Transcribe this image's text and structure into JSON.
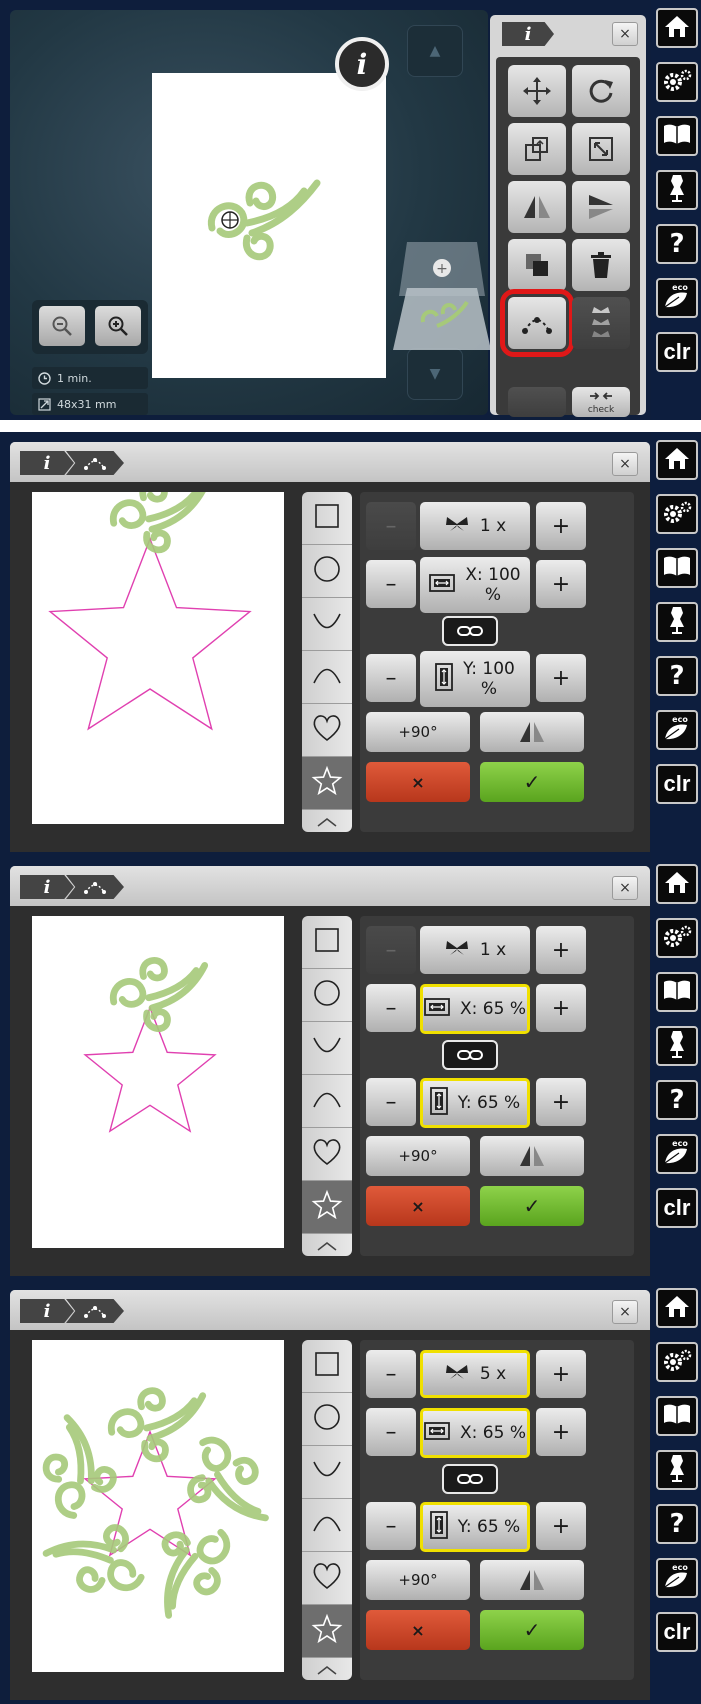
{
  "sidebar": {
    "buttons": [
      {
        "name": "home",
        "icon": "home-icon"
      },
      {
        "name": "setup",
        "icon": "settings-icon"
      },
      {
        "name": "tutorial",
        "icon": "book-icon"
      },
      {
        "name": "consultant",
        "icon": "dress-form-icon"
      },
      {
        "name": "help",
        "icon": "help-icon",
        "label": "?"
      },
      {
        "name": "eco",
        "icon": "eco-leaf-icon",
        "label": "eco"
      },
      {
        "name": "clear",
        "label": "clr"
      }
    ]
  },
  "screen1": {
    "info_label": "i",
    "time": "1 min.",
    "size": "48x31 mm",
    "panel_tab": "i",
    "close": "×",
    "tools": [
      "move",
      "rotate",
      "resize",
      "scale",
      "mirror-left-right",
      "mirror-up-down",
      "duplicate",
      "delete",
      "shape-arc",
      "multi-motif",
      "check"
    ],
    "check_label": "check"
  },
  "panels": [
    {
      "tab_i": "i",
      "close": "×",
      "repeat": "1 x",
      "repeat_minus_enabled": false,
      "repeat_highlight": false,
      "x_value": "X: 100",
      "x_unit": "%",
      "x_highlight": false,
      "y_value": "Y: 100",
      "y_unit": "%",
      "y_highlight": false,
      "rotate_label": "+90°",
      "cancel_label": "×",
      "confirm_label": "✓",
      "star_scale": 1.0,
      "motif_count": 1
    },
    {
      "tab_i": "i",
      "close": "×",
      "repeat": "1 x",
      "repeat_minus_enabled": false,
      "repeat_highlight": false,
      "x_value": "X: 65 %",
      "x_unit": "",
      "x_highlight": true,
      "y_value": "Y: 65 %",
      "y_unit": "",
      "y_highlight": true,
      "rotate_label": "+90°",
      "cancel_label": "×",
      "confirm_label": "✓",
      "star_scale": 0.65,
      "motif_count": 1
    },
    {
      "tab_i": "i",
      "close": "×",
      "repeat": "5 x",
      "repeat_minus_enabled": true,
      "repeat_highlight": true,
      "x_value": "X: 65 %",
      "x_unit": "",
      "x_highlight": true,
      "y_value": "Y: 65 %",
      "y_unit": "",
      "y_highlight": true,
      "rotate_label": "+90°",
      "cancel_label": "×",
      "confirm_label": "✓",
      "star_scale": 0.65,
      "motif_count": 5
    }
  ],
  "shapes": [
    "square",
    "circle",
    "arc-down",
    "arc-up",
    "heart",
    "star"
  ],
  "minus_label": "–",
  "plus_label": "+",
  "colors": {
    "green_motif": "#9cc46e",
    "star_line": "#e040b0",
    "highlight_red": "#e01818",
    "highlight_yellow": "#f0e000"
  }
}
